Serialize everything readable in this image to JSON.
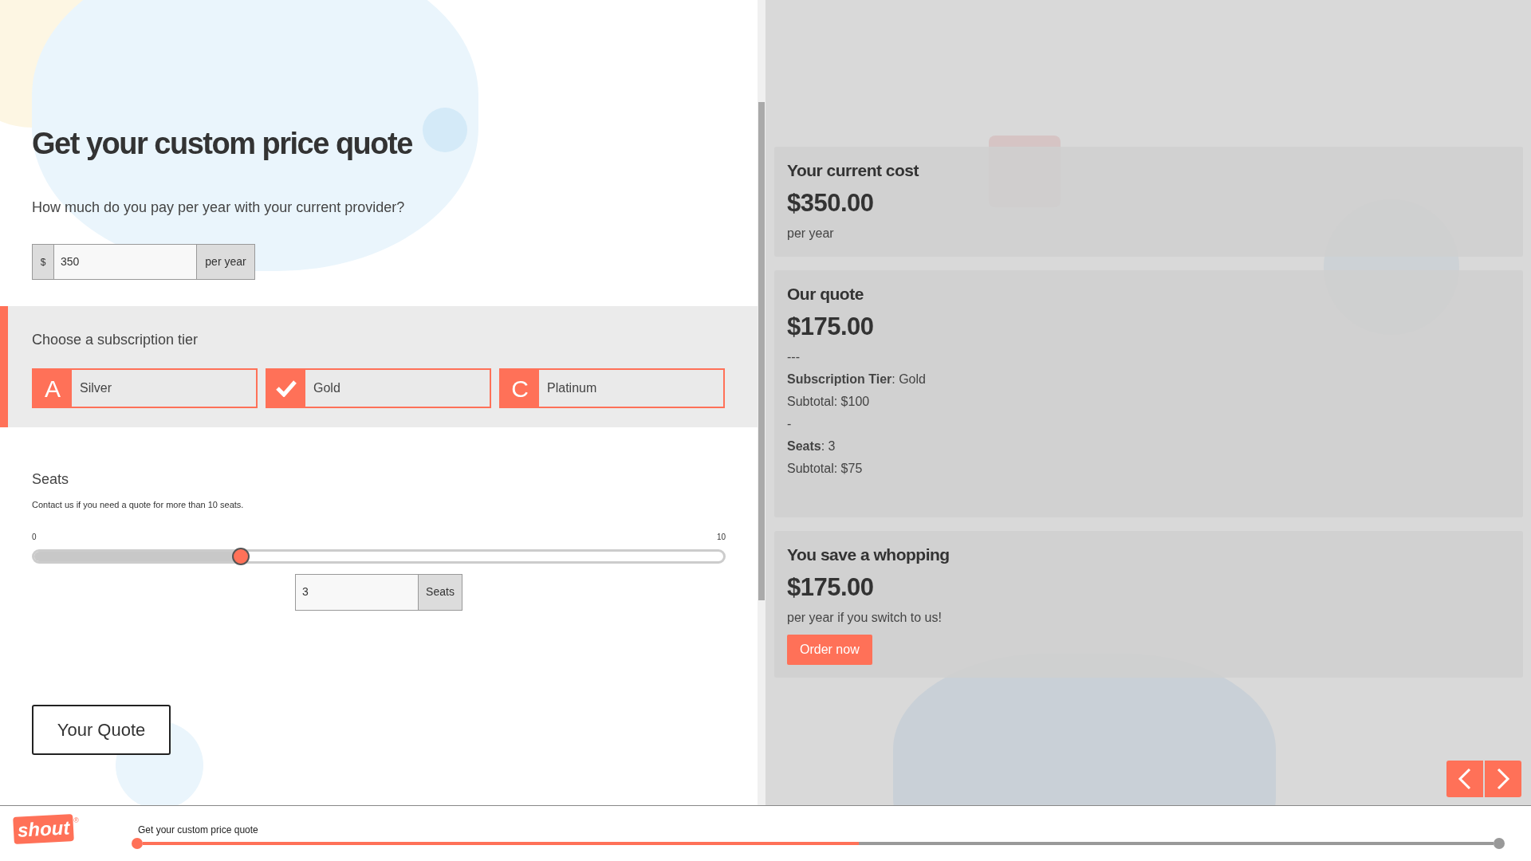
{
  "form": {
    "title": "Get your custom price quote",
    "question": "How much do you pay per year with your current provider?",
    "cost_field": {
      "prefix": "$",
      "value": "350",
      "suffix": "per year"
    },
    "tier_section": {
      "label": "Choose a subscription tier",
      "tiers": [
        {
          "letter": "A",
          "label": "Silver",
          "selected": false
        },
        {
          "label": "Gold",
          "selected": true
        },
        {
          "letter": "C",
          "label": "Platinum",
          "selected": false
        }
      ]
    },
    "seats": {
      "label": "Seats",
      "hint": "Contact us if you need a quote for more than 10 seats.",
      "min": "0",
      "max": "10",
      "level": 0.3,
      "value": "3",
      "suffix": "Seats"
    },
    "submit": "Your Quote"
  },
  "results": [
    {
      "title": "Your current cost",
      "amount": "$350.00",
      "lines": [
        "per year"
      ]
    },
    {
      "title": "Our quote",
      "amount": "$175.00",
      "lines": [
        "---",
        "**Subscription Tier**: Gold",
        "Subtotal: $100",
        "-",
        "**Seats**: 3",
        "Subtotal: $75"
      ]
    },
    {
      "title": "You save a whopping",
      "amount": "$175.00",
      "lines": [
        "per year if you switch to us!"
      ],
      "button": "Order now"
    }
  ],
  "player": {
    "logo": "shout",
    "logo_mark": "®",
    "slide_title": "Get your custom price quote",
    "level": 0.53
  }
}
